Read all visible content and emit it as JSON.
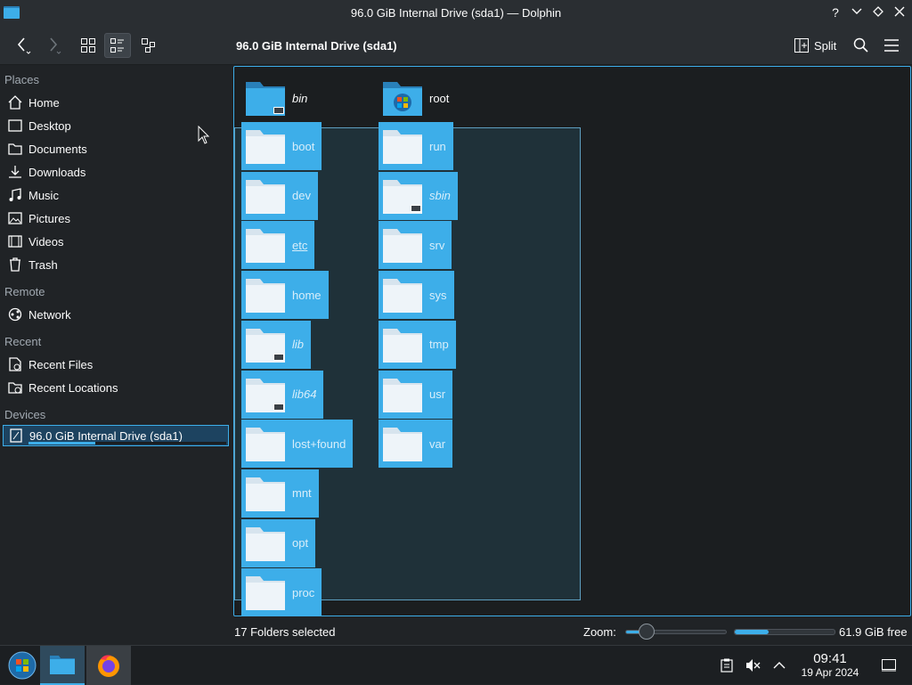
{
  "window": {
    "title": "96.0 GiB Internal Drive (sda1) — Dolphin"
  },
  "toolbar": {
    "location": "96.0 GiB Internal Drive (sda1)",
    "split_label": "Split"
  },
  "sidebar": {
    "places_header": "Places",
    "places": [
      "Home",
      "Desktop",
      "Documents",
      "Downloads",
      "Music",
      "Pictures",
      "Videos",
      "Trash"
    ],
    "remote_header": "Remote",
    "remote": [
      "Network"
    ],
    "recent_header": "Recent",
    "recent": [
      "Recent Files",
      "Recent Locations"
    ],
    "devices_header": "Devices",
    "devices": [
      "96.0 GiB Internal Drive (sda1)"
    ],
    "device_usage_fraction": 0.34
  },
  "files": {
    "col1": [
      "bin",
      "boot",
      "dev",
      "etc",
      "home",
      "lib",
      "lib64",
      "lost+found",
      "mnt",
      "opt",
      "proc"
    ],
    "col2": [
      "root",
      "run",
      "sbin",
      "srv",
      "sys",
      "tmp",
      "usr",
      "var"
    ]
  },
  "status": {
    "selection": "17 Folders selected",
    "zoom_label": "Zoom:",
    "zoom_fraction": 0.17,
    "free_space": "61.9 GiB free",
    "used_fraction": 0.34
  },
  "clock": {
    "time": "09:41",
    "date": "19 Apr 2024"
  },
  "colors": {
    "accent": "#3daee9",
    "background": "#202326",
    "view": "#1b1e20"
  }
}
